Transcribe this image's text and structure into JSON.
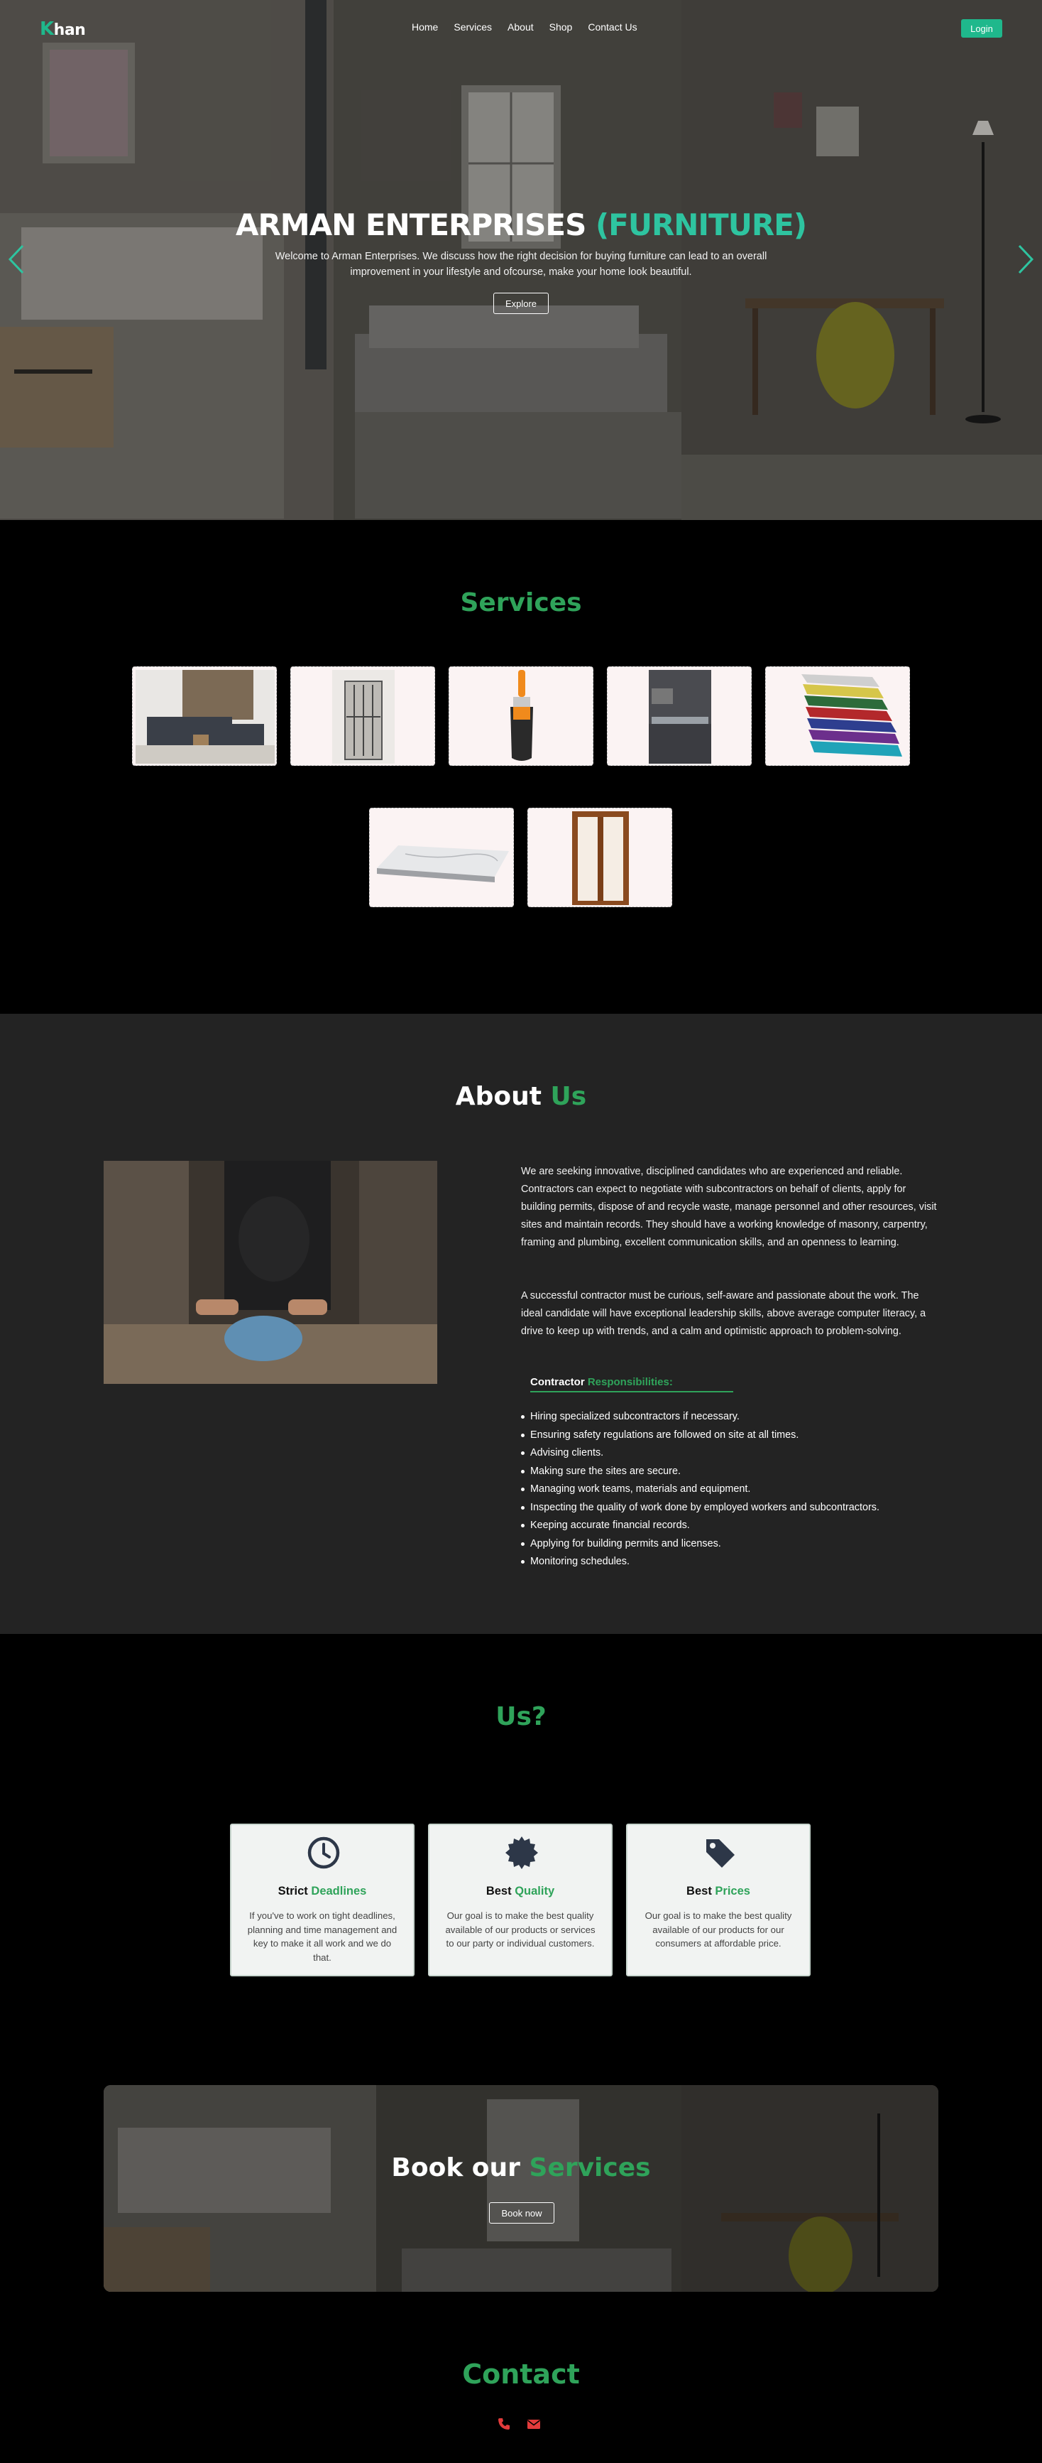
{
  "nav": {
    "logo_first": "K",
    "logo_rest": "han",
    "links": [
      "Home",
      "Services",
      "About",
      "Shop",
      "Contact Us"
    ],
    "login_label": "Login"
  },
  "hero": {
    "title_main": "ARMAN ENTERPRISES",
    "title_accent": "(FURNITURE)",
    "subtitle": "Welcome to Arman Enterprises. We discuss how the right decision for buying furniture can lead to an overall improvement in your lifestyle and ofcourse, make your home look beautiful.",
    "explore_label": "Explore",
    "prev_icon": "chevron-left-icon",
    "next_icon": "chevron-right-icon"
  },
  "services": {
    "title": "Services",
    "items": [
      "sofa-image",
      "door-image",
      "paint-brush-image",
      "kitchen-image",
      "roofing-sheets-image",
      "marble-slab-image",
      "wooden-window-image"
    ]
  },
  "about": {
    "title_main": "About",
    "title_accent": "Us",
    "para1": "We are seeking innovative, disciplined candidates who are experienced and reliable. Contractors can expect to negotiate with subcontractors on behalf of clients, apply for building permits, dispose of and recycle waste, manage personnel and other resources, visit sites and maintain records. They should have a working knowledge of masonry, carpentry, framing and plumbing, excellent communication skills, and an openness to learning.",
    "para2": "A successful contractor must be curious, self-aware and passionate about the work. The ideal candidate will have exceptional leadership skills, above average computer literacy, a drive to keep up with trends, and a calm and optimistic approach to problem-solving.",
    "resp_main": "Contractor",
    "resp_accent": "Responsibilities:",
    "responsibilities": [
      "Hiring specialized subcontractors if necessary.",
      "Ensuring safety regulations are followed on site at all times.",
      "Advising clients.",
      "Making sure the sites are secure.",
      "Managing work teams, materials and equipment.",
      "Inspecting the quality of work done by employed workers and subcontractors.",
      "Keeping accurate financial records.",
      "Applying for building permits and licenses.",
      "Monitoring schedules."
    ]
  },
  "why": {
    "title": "Us?",
    "features": [
      {
        "icon": "clock-icon",
        "title_main": "Strict",
        "title_accent": "Deadlines",
        "desc": "If you've to work on tight deadlines, planning and time management and key to make it all work and we do that."
      },
      {
        "icon": "badge-icon",
        "title_main": "Best",
        "title_accent": "Quality",
        "desc": "Our goal is to make the best quality available of our products or services to our party or individual customers."
      },
      {
        "icon": "price-tag-icon",
        "title_main": "Best",
        "title_accent": "Prices",
        "desc": "Our goal is to make the best quality available of our products for our consumers at affordable price."
      }
    ]
  },
  "book": {
    "title_main": "Book our",
    "title_accent": "Services",
    "button_label": "Book now"
  },
  "contact": {
    "title": "Contact",
    "icons": [
      "phone-icon",
      "envelope-icon"
    ],
    "icon_color": "#e23b3b"
  },
  "colors": {
    "accent_teal": "#1fb88c",
    "accent_green": "#2fa35a",
    "about_bg": "#232323"
  }
}
